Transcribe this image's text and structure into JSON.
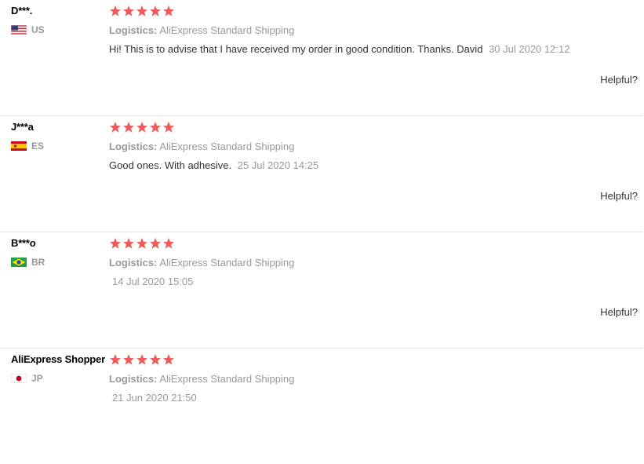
{
  "reviews": [
    {
      "user": "D***.",
      "country": "US",
      "rating": 5,
      "logistics_label": "Logistics:",
      "logistics_value": "AliExpress Standard Shipping",
      "text": "Hi! This is to advise that I have received my order in good condition. Thanks. David",
      "date": "30 Jul 2020 12:12",
      "helpful": "Helpful?"
    },
    {
      "user": "J***a",
      "country": "ES",
      "rating": 5,
      "logistics_label": "Logistics:",
      "logistics_value": "AliExpress Standard Shipping",
      "text": "Good ones. With adhesive.",
      "date": "25 Jul 2020 14:25",
      "helpful": "Helpful?"
    },
    {
      "user": "B***o",
      "country": "BR",
      "rating": 5,
      "logistics_label": "Logistics:",
      "logistics_value": "AliExpress Standard Shipping",
      "text": "",
      "date": "14 Jul 2020 15:05",
      "helpful": "Helpful?"
    },
    {
      "user": "AliExpress Shopper",
      "country": "JP",
      "rating": 5,
      "logistics_label": "Logistics:",
      "logistics_value": "AliExpress Standard Shipping",
      "text": "",
      "date": "21 Jun 2020 21:50"
    }
  ],
  "colors": {
    "star": "#f05a5a",
    "muted": "#999999",
    "divider": "#e6e6e6"
  }
}
